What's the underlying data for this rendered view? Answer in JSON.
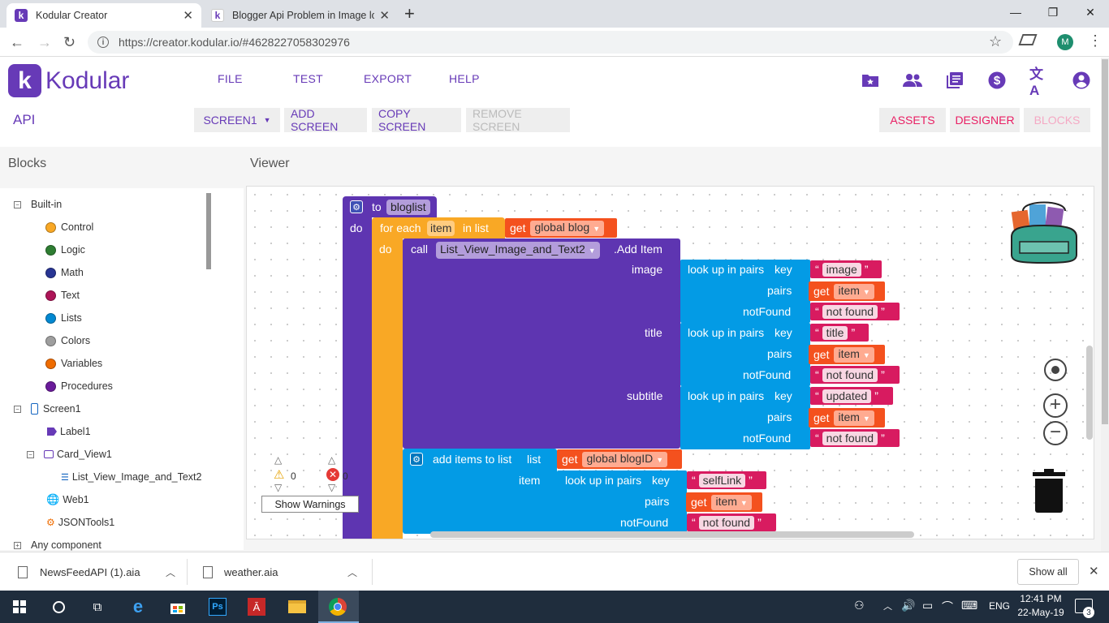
{
  "browser": {
    "tabs": [
      {
        "title": "Kodular Creator",
        "favicon": "k",
        "active": true
      },
      {
        "title": "Blogger Api Problem in Image lo",
        "favicon": "k",
        "active": false
      }
    ],
    "new_tab": "+",
    "window": {
      "minimize": "—",
      "maximize": "❐",
      "close": "✕"
    },
    "url": "https://creator.kodular.io/#4628227058302976",
    "profile_initial": "M"
  },
  "app": {
    "logo_letter": "k",
    "name": "Kodular",
    "menu": [
      "FILE",
      "TEST",
      "EXPORT",
      "HELP"
    ],
    "project": "API",
    "screen_select": "SCREEN1",
    "screen_buttons": [
      "ADD SCREEN",
      "COPY SCREEN",
      "REMOVE SCREEN"
    ],
    "mode_buttons": [
      "ASSETS",
      "DESIGNER",
      "BLOCKS"
    ],
    "brand_color": "#673ab7",
    "accent_color": "#e91e63"
  },
  "blocks_panel": {
    "title": "Blocks",
    "builtin": "Built-in",
    "builtin_items": [
      {
        "label": "Control",
        "color": "#f9a825"
      },
      {
        "label": "Logic",
        "color": "#2e7d32"
      },
      {
        "label": "Math",
        "color": "#283593"
      },
      {
        "label": "Text",
        "color": "#ad1457"
      },
      {
        "label": "Lists",
        "color": "#0288d1"
      },
      {
        "label": "Colors",
        "color": "#9e9e9e"
      },
      {
        "label": "Variables",
        "color": "#ef6c00"
      },
      {
        "label": "Procedures",
        "color": "#6a1b9a"
      }
    ],
    "components": {
      "screen": "Screen1",
      "label": "Label1",
      "card": "Card_View1",
      "list_view": "List_View_Image_and_Text2",
      "web": "Web1",
      "json": "JSONTools1"
    },
    "any_component": "Any component"
  },
  "viewer": {
    "title": "Viewer",
    "procedure": {
      "to": "to",
      "name": "bloglist",
      "do": "do"
    },
    "foreach": {
      "for_each": "for each",
      "var": "item",
      "in_list": "in list",
      "do": "do"
    },
    "get": "get",
    "global_blog": "global blog",
    "call": {
      "call": "call",
      "component": "List_View_Image_and_Text2",
      "method": ".Add Item"
    },
    "sockets": {
      "image": "image",
      "title": "title",
      "subtitle": "subtitle",
      "item": "item"
    },
    "lookup": {
      "label": "look up in pairs",
      "key": "key",
      "pairs": "pairs",
      "notfound": "notFound"
    },
    "strings": {
      "image": "image",
      "title": "title",
      "updated": "updated",
      "not_found": "not found",
      "selfLink": "selfLink"
    },
    "add_items": {
      "label": "add items to list",
      "list": "list",
      "global_blogID": "global blogID"
    },
    "warnings": {
      "warn_count": "0",
      "error_count": "0",
      "button": "Show Warnings"
    }
  },
  "downloads": {
    "items": [
      "NewsFeedAPI (1).aia",
      "weather.aia"
    ],
    "show_all": "Show all"
  },
  "taskbar": {
    "lang": "ENG",
    "time": "12:41 PM",
    "date": "22-May-19",
    "notifications": "3"
  }
}
